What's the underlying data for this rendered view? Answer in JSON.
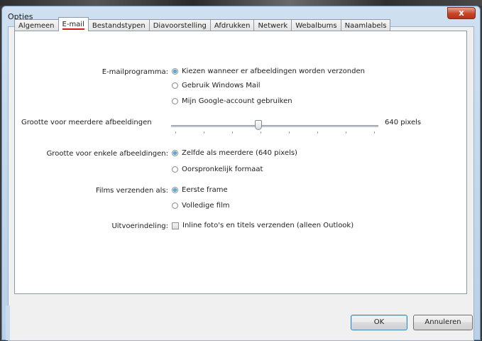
{
  "window": {
    "title": "Opties",
    "close_label": "x"
  },
  "tabs": [
    {
      "label": "Algemeen",
      "active": false
    },
    {
      "label": "E-mail",
      "active": true
    },
    {
      "label": "Bestandstypen",
      "active": false
    },
    {
      "label": "Diavoorstelling",
      "active": false
    },
    {
      "label": "Afdrukken",
      "active": false
    },
    {
      "label": "Netwerk",
      "active": false
    },
    {
      "label": "Webalbums",
      "active": false
    },
    {
      "label": "Naamlabels",
      "active": false
    }
  ],
  "email_program": {
    "label": "E-mailprogramma:",
    "options": [
      {
        "label": "Kiezen wanneer er afbeeldingen worden verzonden",
        "checked": true
      },
      {
        "label": "Gebruik Windows Mail",
        "checked": false
      },
      {
        "label": "Mijn Google-account gebruiken",
        "checked": false
      }
    ]
  },
  "multi_size": {
    "label": "Grootte voor meerdere afbeeldingen",
    "value_text": "640 pixels",
    "level_fraction": 0.42
  },
  "single_size": {
    "label": "Grootte voor enkele afbeeldingen:",
    "options": [
      {
        "label": "Zelfde als meerdere (640 pixels)",
        "checked": true
      },
      {
        "label": "Oorspronkelijk formaat",
        "checked": false
      }
    ]
  },
  "movies": {
    "label": "Films verzenden als:",
    "options": [
      {
        "label": "Eerste frame",
        "checked": true
      },
      {
        "label": "Volledige film",
        "checked": false
      }
    ]
  },
  "layout": {
    "label": "Uitvoerindeling:",
    "checkbox_label": "Inline foto's en titels verzenden (alleen Outlook)",
    "checked": false
  },
  "buttons": {
    "ok": "OK",
    "cancel": "Annuleren"
  }
}
